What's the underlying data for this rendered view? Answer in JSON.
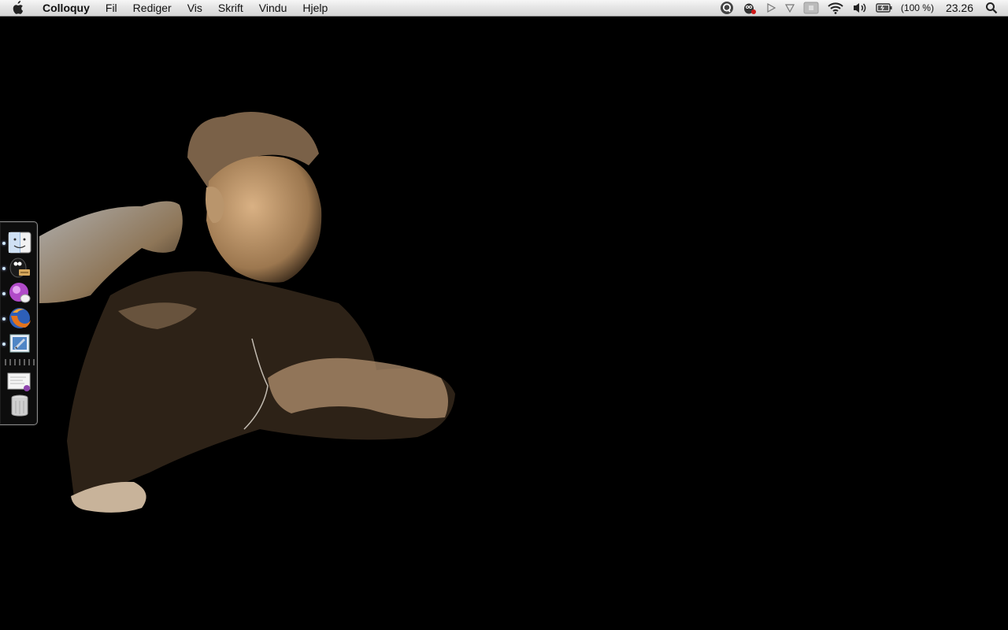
{
  "menubar": {
    "app_name": "Colloquy",
    "menus": [
      "Fil",
      "Rediger",
      "Vis",
      "Skrift",
      "Vindu",
      "Hjelp"
    ],
    "battery_text": "(100 %)",
    "clock": "23.26",
    "status_icons": [
      "quicksilver-icon",
      "adium-icon",
      "play-icon",
      "down-arrow-icon",
      "display-icon",
      "wifi-icon",
      "volume-icon",
      "battery-icon",
      "spotlight-icon"
    ]
  },
  "dock": {
    "items": [
      {
        "name": "finder",
        "running": true
      },
      {
        "name": "adium",
        "running": true
      },
      {
        "name": "colloquy",
        "running": true
      },
      {
        "name": "firefox",
        "running": true
      },
      {
        "name": "mail",
        "running": true
      },
      {
        "name": "document-stack",
        "running": false
      },
      {
        "name": "trash",
        "running": false
      }
    ]
  },
  "colors": {
    "menubar_top": "#f6f6f6",
    "menubar_bottom": "#d6d6d6",
    "desktop_background": "#000000",
    "photo_tint": "#c8a06e"
  }
}
